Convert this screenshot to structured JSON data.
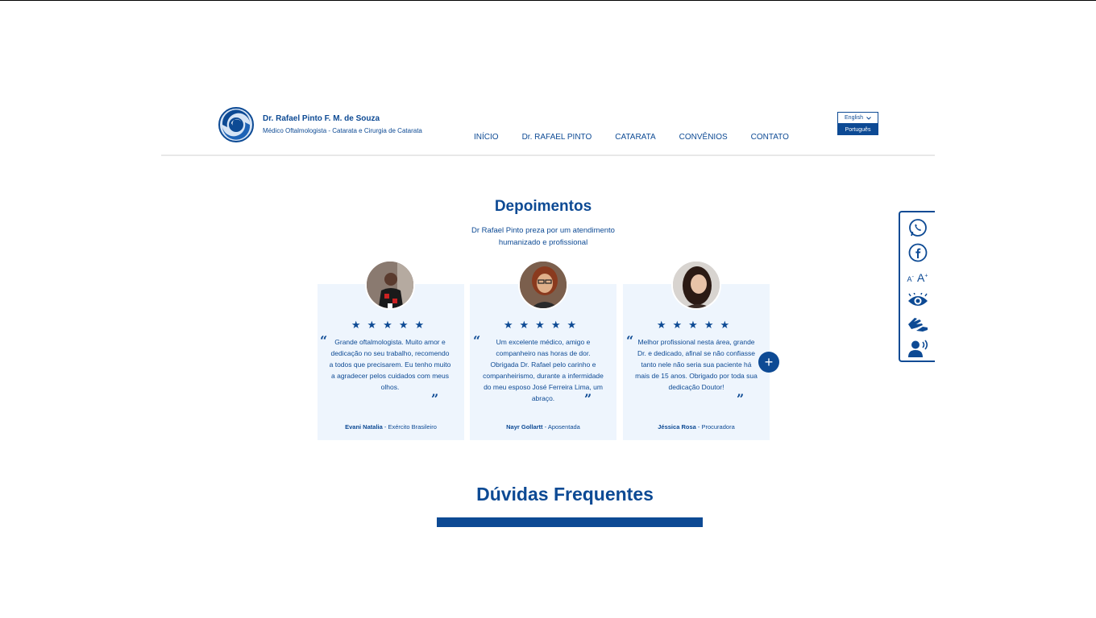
{
  "header": {
    "brand_name": "Dr. Rafael Pinto F. M. de Souza",
    "brand_subtitle": "Médico Oftalmologista - Catarata e Cirurgia de Catarata",
    "nav": [
      "INÍCIO",
      "Dr. RAFAEL PINTO",
      "CATARATA",
      "CONVÊNIOS",
      "CONTATO"
    ],
    "language": {
      "selected": "English",
      "options": [
        "Português"
      ]
    }
  },
  "testimonials": {
    "title": "Depoimentos",
    "subtitle": "Dr Rafael Pinto preza por um atendimento humanizado e profissional",
    "stars": "★★★★★",
    "cards": [
      {
        "quote": "Grande oftalmologista. Muito amor e dedicação no seu trabalho, recomendo a todos que precisarem. Eu tenho muito a agradecer pelos cuidados com meus olhos.",
        "name": "Evani Natalia",
        "role": " - Exército Brasileiro"
      },
      {
        "quote": "Um excelente médico, amigo e companheiro nas horas de dor. Obrigada Dr. Rafael pelo carinho e companheirismo, durante a infermidade do meu esposo José Ferreira Lima, um abraço.",
        "name": "Nayr Gollartt",
        "role": " - Aposentada"
      },
      {
        "quote": "Melhor profissional nesta área, grande Dr. e dedicado, afinal se não confiasse tanto nele não seria sua paciente há mais de 15 anos. Obrigado por toda sua dedicação Doutor!",
        "name": "Jéssica Rosa",
        "role": " - Procuradora"
      }
    ],
    "next_button": "+"
  },
  "accessibility": {
    "font_small": "A",
    "font_small_sign": "-",
    "font_big": "A",
    "font_big_sign": "+",
    "icons": [
      "whatsapp-icon",
      "facebook-icon",
      "font-size-icon",
      "contrast-eye-icon",
      "sign-language-icon",
      "voice-reader-icon"
    ]
  },
  "faq": {
    "title": "Dúvidas Frequentes"
  },
  "colors": {
    "primary": "#0d4a94",
    "card_bg": "#eef5fd"
  }
}
